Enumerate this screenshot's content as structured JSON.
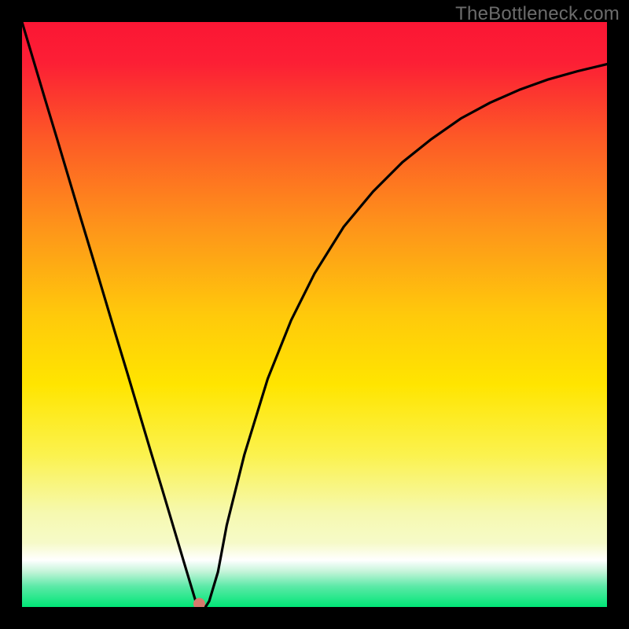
{
  "attribution": "TheBottleneck.com",
  "chart_data": {
    "type": "line",
    "title": "",
    "xlabel": "",
    "ylabel": "",
    "xlim": [
      0,
      1
    ],
    "ylim": [
      0,
      1
    ],
    "x": [
      0.0,
      0.02,
      0.04,
      0.06,
      0.08,
      0.1,
      0.12,
      0.14,
      0.16,
      0.18,
      0.2,
      0.22,
      0.24,
      0.26,
      0.28,
      0.295,
      0.3,
      0.305,
      0.31,
      0.315,
      0.32,
      0.335,
      0.35,
      0.38,
      0.42,
      0.46,
      0.5,
      0.55,
      0.6,
      0.65,
      0.7,
      0.75,
      0.8,
      0.85,
      0.9,
      0.95,
      1.0
    ],
    "values": [
      1.0,
      0.933,
      0.866,
      0.8,
      0.733,
      0.666,
      0.6,
      0.533,
      0.466,
      0.4,
      0.333,
      0.266,
      0.2,
      0.133,
      0.066,
      0.016,
      0.0,
      0.0,
      0.0,
      0.002,
      0.01,
      0.06,
      0.14,
      0.26,
      0.39,
      0.49,
      0.57,
      0.65,
      0.71,
      0.76,
      0.8,
      0.835,
      0.862,
      0.884,
      0.902,
      0.916,
      0.928
    ],
    "minimum_marker": {
      "x": 0.303,
      "y": 0.0
    },
    "background_gradient": [
      "#FB1735",
      "#FB1735",
      "#FFDF00",
      "#FFDF00",
      "#F6F9B0",
      "#F6F9B0",
      "#FFFFFF",
      "#00E676"
    ]
  }
}
